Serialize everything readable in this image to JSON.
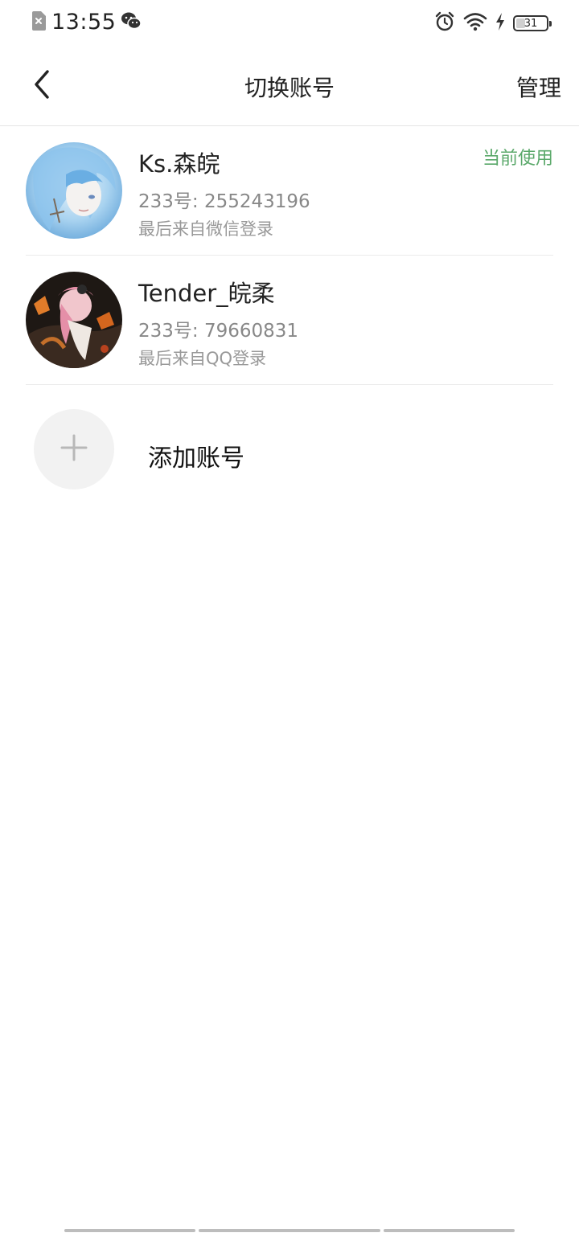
{
  "status_bar": {
    "time": "13:55",
    "battery_level": 31,
    "battery_text": "31",
    "icons": [
      "sim-off-icon",
      "wechat-icon",
      "alarm-icon",
      "wifi-icon",
      "charging-icon",
      "battery-icon"
    ]
  },
  "nav": {
    "title": "切换账号",
    "manage_label": "管理",
    "back_icon": "chevron-left-icon"
  },
  "accounts": [
    {
      "name": "Ks.森皖",
      "id_line": "233号: 255243196",
      "login_line": "最后来自微信登录",
      "badge": "当前使用"
    },
    {
      "name": "Tender_皖柔",
      "id_line": "233号: 79660831",
      "login_line": "最后来自QQ登录"
    }
  ],
  "add_account": {
    "label": "添加账号",
    "icon": "plus-icon"
  },
  "colors": {
    "accent_green": "#5aa86a",
    "text_primary": "#222222",
    "text_secondary": "#888888",
    "divider": "#ebebeb"
  }
}
